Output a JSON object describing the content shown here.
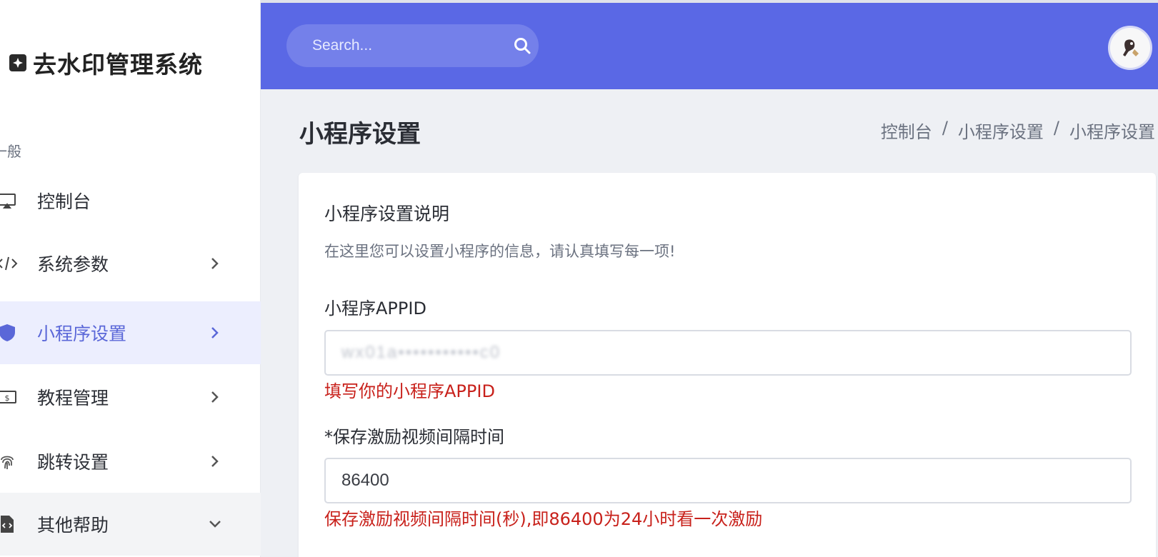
{
  "sidebar": {
    "brand": {
      "title": "去水印管理系统",
      "icon": "plus-square-icon"
    },
    "section_label": "一般",
    "items": [
      {
        "label": "控制台",
        "icon": "monitor-icon",
        "chevron": ""
      },
      {
        "label": "系统参数",
        "icon": "code-icon",
        "chevron": "right"
      },
      {
        "label": "小程序设置",
        "icon": "shield-icon",
        "chevron": "right",
        "active": true
      },
      {
        "label": "教程管理",
        "icon": "money-icon",
        "chevron": "right"
      },
      {
        "label": "跳转设置",
        "icon": "fingerprint-icon",
        "chevron": "right"
      },
      {
        "label": "其他帮助",
        "icon": "file-code-icon",
        "chevron": "down"
      }
    ]
  },
  "header": {
    "search_placeholder": "Search...",
    "search_icon": "search-icon",
    "avatar_icon": "avatar-icon"
  },
  "page": {
    "title": "小程序设置",
    "breadcrumb": [
      "控制台",
      "小程序设置",
      "小程序设置"
    ],
    "breadcrumb_sep": "/"
  },
  "card": {
    "title": "小程序设置说明",
    "description": "在这里您可以设置小程序的信息，请认真填写每一项!",
    "fields": [
      {
        "label": "小程序APPID",
        "value": "wx01a•••••••••••c0",
        "help": "填写你的小程序APPID"
      },
      {
        "label": "*保存激励视频间隔时间",
        "value": "86400",
        "help": "保存激励视频间隔时间(秒),即86400为24小时看一次激励"
      }
    ]
  },
  "colors": {
    "header_bg": "#5a68e5",
    "accent": "#5a67d8",
    "help_text": "#c8211b",
    "active_item_bg": "#eceefe"
  }
}
